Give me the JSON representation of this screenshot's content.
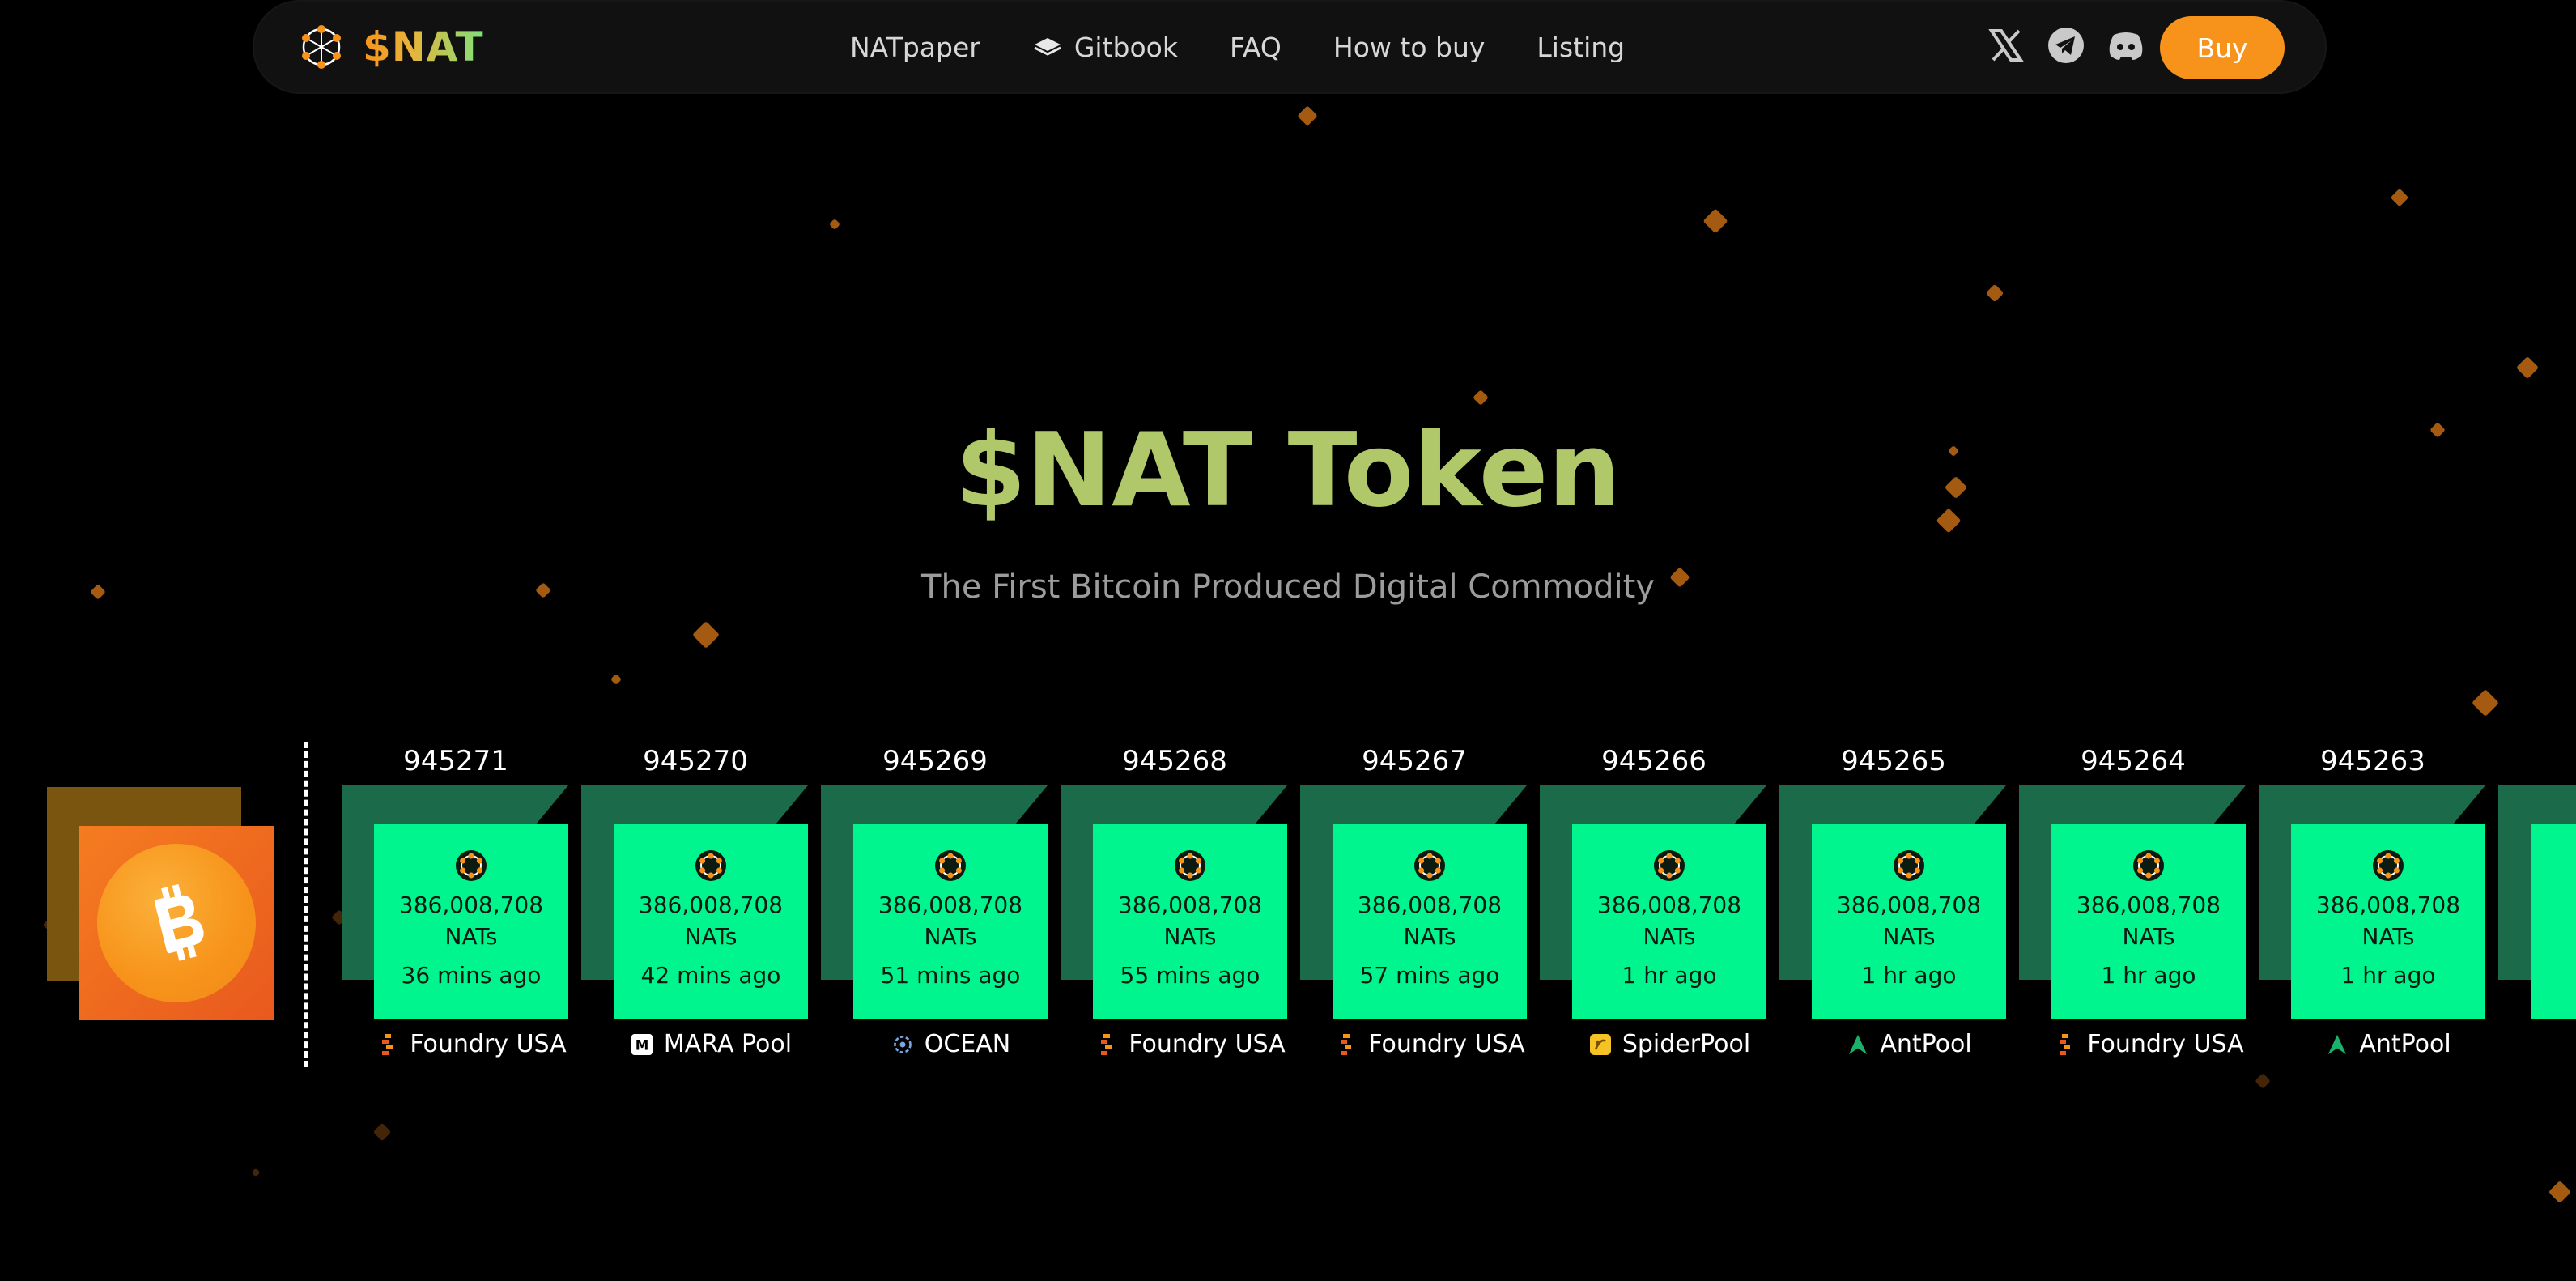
{
  "nav": {
    "brand": "$NAT",
    "links": [
      {
        "label": "NATpaper",
        "icon": "none"
      },
      {
        "label": "Gitbook",
        "icon": "book-icon"
      },
      {
        "label": "FAQ",
        "icon": "none"
      },
      {
        "label": "How to buy",
        "icon": "none"
      },
      {
        "label": "Listing",
        "icon": "none"
      }
    ],
    "social": [
      "x-icon",
      "telegram-icon",
      "discord-icon"
    ],
    "buy_label": "Buy"
  },
  "hero": {
    "title": "$NAT Token",
    "subtitle": "The First Bitcoin Produced Digital Commodity"
  },
  "colors": {
    "accent_orange": "#f7931a",
    "title_green": "#b1c86a",
    "block_green": "#00f58e",
    "block_side": "#1b6b4a"
  },
  "blocks": [
    {
      "number": "945271",
      "amount": "386,008,708",
      "unit": "NATs",
      "time": "36 mins ago",
      "pool": "Foundry USA",
      "pool_icon": "foundry-icon"
    },
    {
      "number": "945270",
      "amount": "386,008,708",
      "unit": "NATs",
      "time": "42 mins ago",
      "pool": "MARA Pool",
      "pool_icon": "mara-icon"
    },
    {
      "number": "945269",
      "amount": "386,008,708",
      "unit": "NATs",
      "time": "51 mins ago",
      "pool": "OCEAN",
      "pool_icon": "ocean-icon"
    },
    {
      "number": "945268",
      "amount": "386,008,708",
      "unit": "NATs",
      "time": "55 mins ago",
      "pool": "Foundry USA",
      "pool_icon": "foundry-icon"
    },
    {
      "number": "945267",
      "amount": "386,008,708",
      "unit": "NATs",
      "time": "57 mins ago",
      "pool": "Foundry USA",
      "pool_icon": "foundry-icon"
    },
    {
      "number": "945266",
      "amount": "386,008,708",
      "unit": "NATs",
      "time": "1 hr ago",
      "pool": "SpiderPool",
      "pool_icon": "spiderpool-icon"
    },
    {
      "number": "945265",
      "amount": "386,008,708",
      "unit": "NATs",
      "time": "1 hr ago",
      "pool": "AntPool",
      "pool_icon": "antpool-icon"
    },
    {
      "number": "945264",
      "amount": "386,008,708",
      "unit": "NATs",
      "time": "1 hr ago",
      "pool": "Foundry USA",
      "pool_icon": "foundry-icon"
    },
    {
      "number": "945263",
      "amount": "386,008,708",
      "unit": "NATs",
      "time": "1 hr ago",
      "pool": "AntPool",
      "pool_icon": "antpool-icon"
    }
  ]
}
